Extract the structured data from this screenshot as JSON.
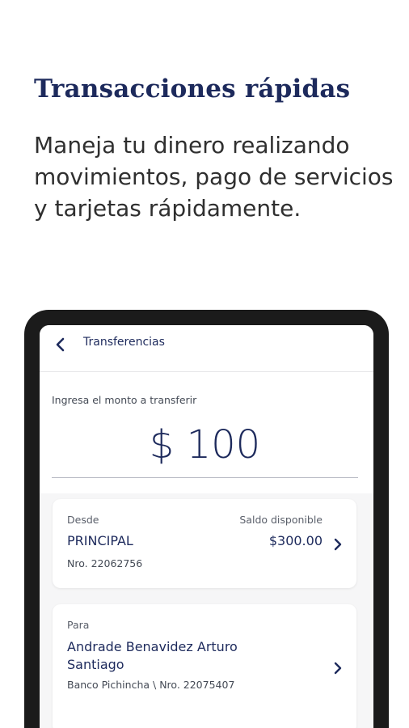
{
  "promo": {
    "title": "Transacciones rápidas",
    "description": "Maneja tu dinero realizando\nmovimientos, pago de servicios\ny tarjetas rápidamente."
  },
  "app": {
    "header": {
      "title": "Transferencias",
      "back_icon": "chevron-left-icon"
    },
    "amount": {
      "label": "Ingresa el monto a transferir",
      "value": "$ 100"
    },
    "from_account": {
      "label": "Desde",
      "name": "PRINCIPAL",
      "number": "Nro. 22062756",
      "balance_label": "Saldo disponible",
      "balance": "$300.00",
      "chevron_icon": "chevron-right-icon"
    },
    "to_account": {
      "label": "Para",
      "name": "Andrade Benavidez Arturo\nSantiago",
      "bank": "Banco Pichincha \\ Nro. 22075407",
      "chevron_icon": "chevron-right-icon"
    }
  },
  "colors": {
    "brand_navy": "#1d2a5c",
    "device_frame": "#1b1b1b",
    "screen_bg": "#f6f6f7"
  }
}
